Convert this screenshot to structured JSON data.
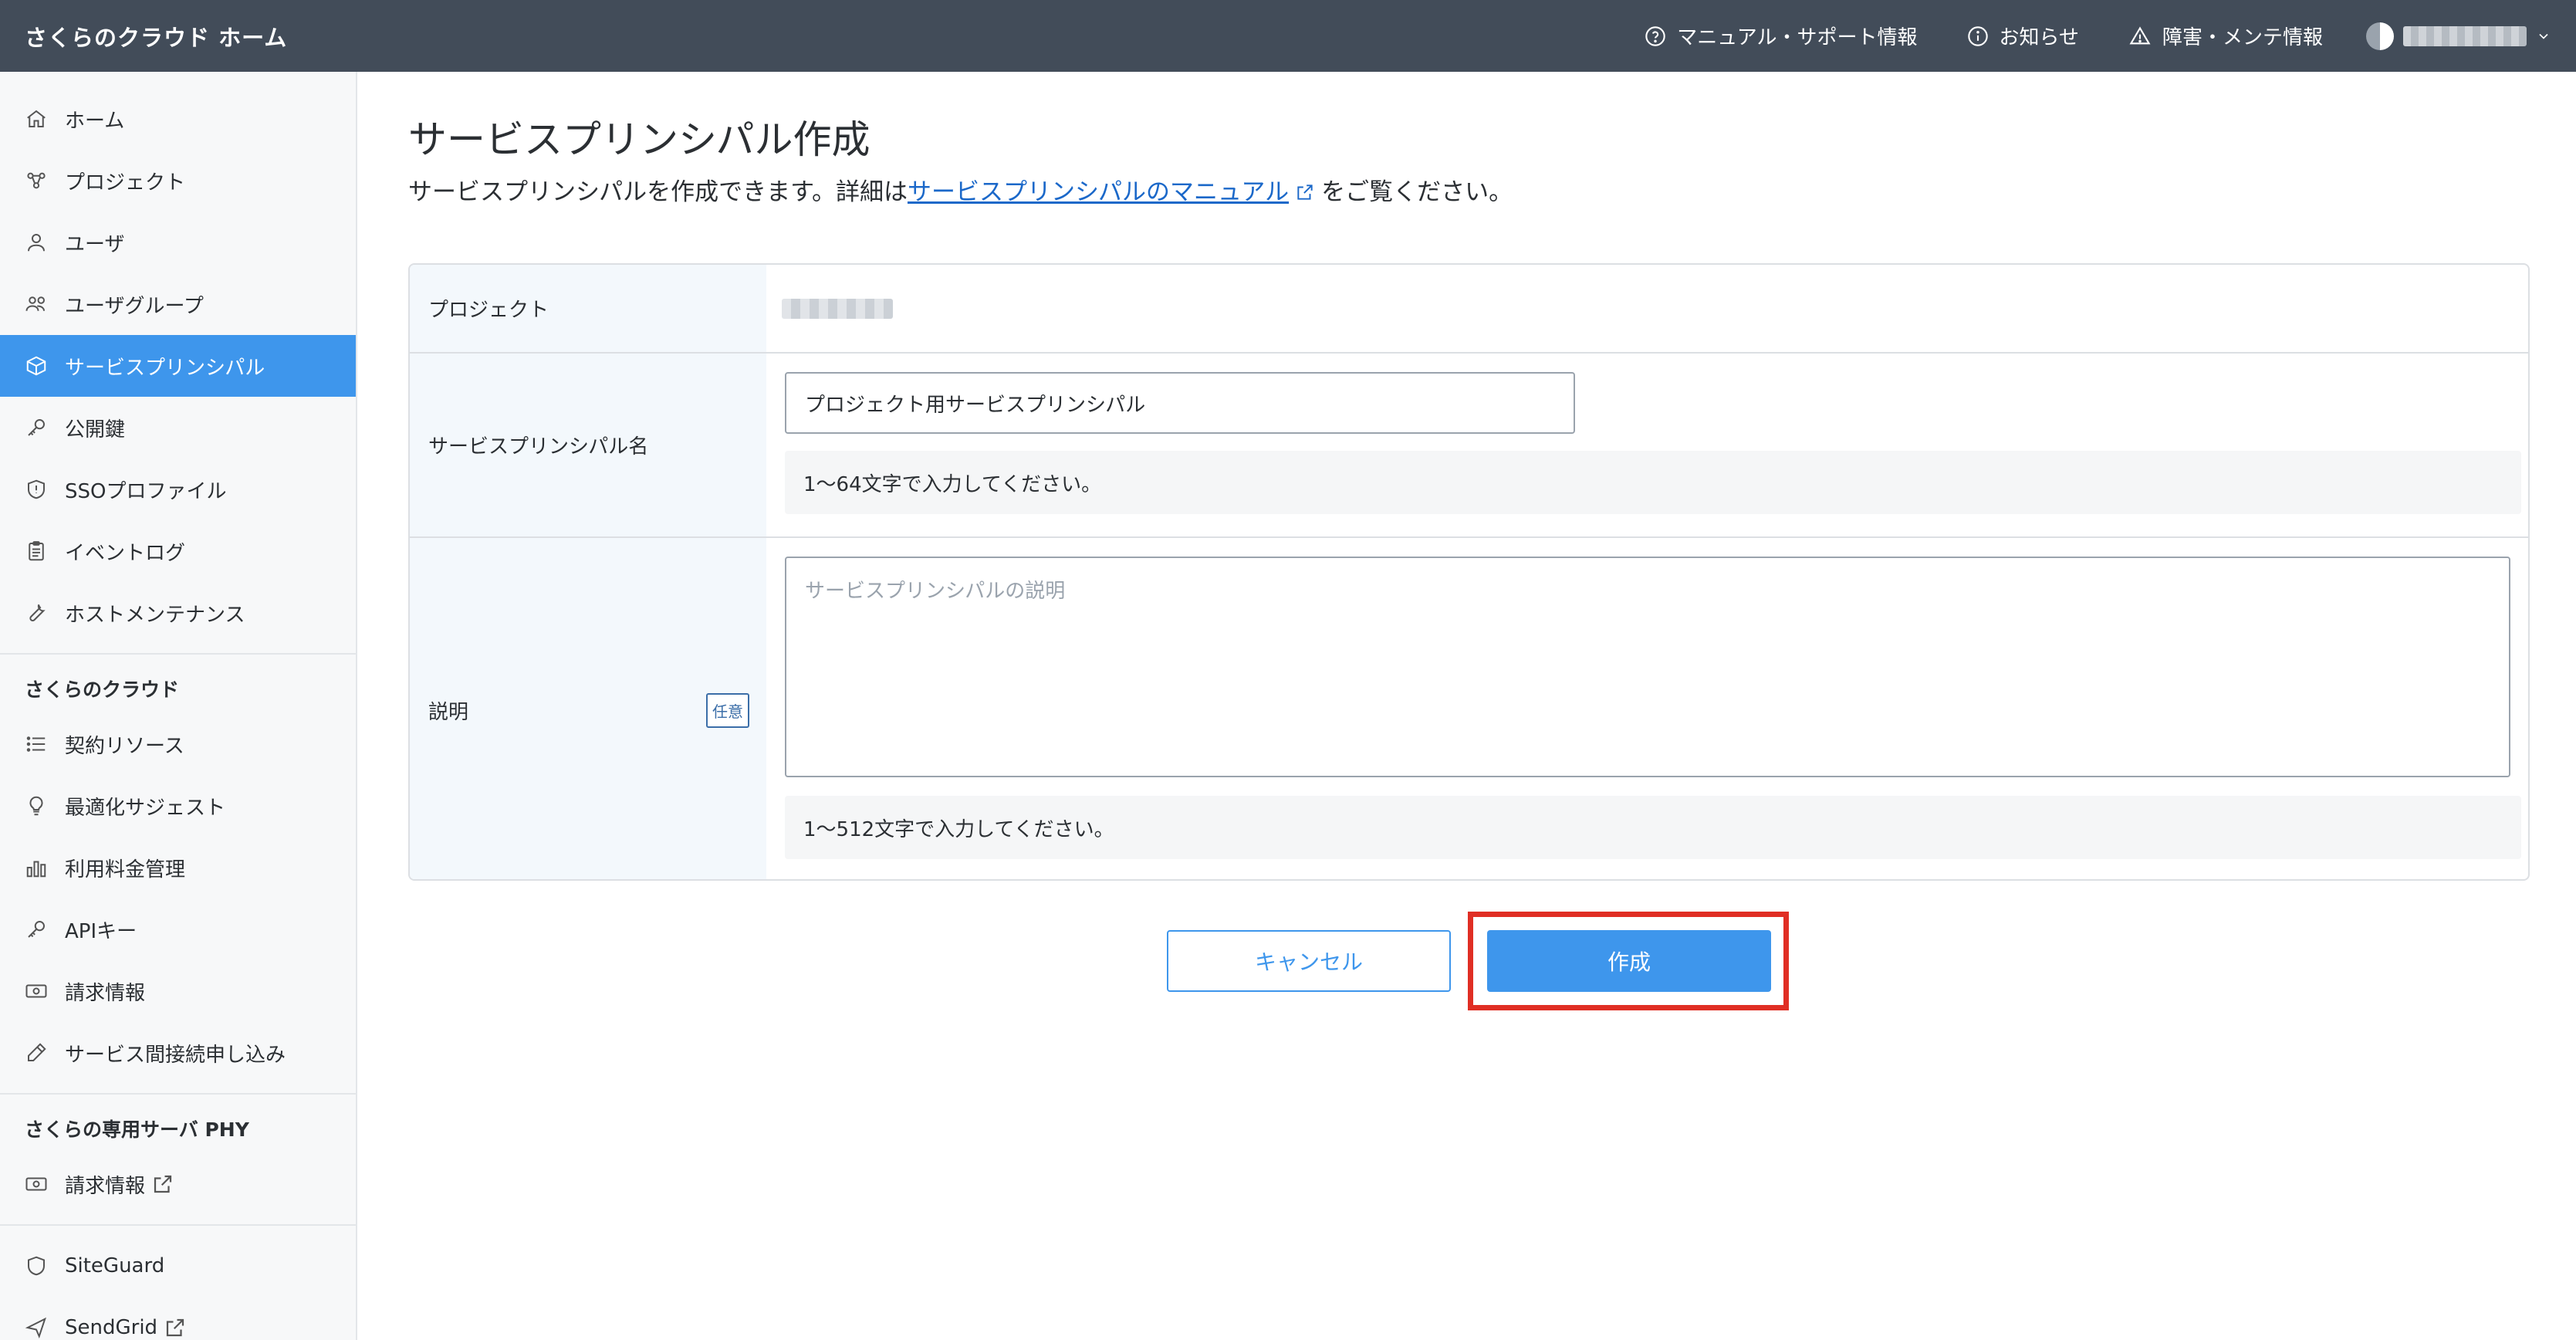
{
  "header": {
    "brand": "さくらのクラウド ホーム",
    "nav": [
      {
        "icon": "help-circle-icon",
        "label": "マニュアル・サポート情報"
      },
      {
        "icon": "info-circle-icon",
        "label": "お知らせ"
      },
      {
        "icon": "warning-triangle-icon",
        "label": "障害・メンテ情報"
      }
    ]
  },
  "sidebar": {
    "items": [
      {
        "icon": "home-icon",
        "label": "ホーム"
      },
      {
        "icon": "project-icon",
        "label": "プロジェクト"
      },
      {
        "icon": "user-icon",
        "label": "ユーザ"
      },
      {
        "icon": "user-group-icon",
        "label": "ユーザグループ"
      },
      {
        "icon": "cube-icon",
        "label": "サービスプリンシパル",
        "active": true
      },
      {
        "icon": "key-icon",
        "label": "公開鍵"
      },
      {
        "icon": "shield-icon",
        "label": "SSOプロファイル"
      },
      {
        "icon": "clipboard-icon",
        "label": "イベントログ"
      },
      {
        "icon": "wrench-icon",
        "label": "ホストメンテナンス"
      }
    ],
    "section_cloud": {
      "heading": "さくらのクラウド",
      "items": [
        {
          "icon": "list-icon",
          "label": "契約リソース"
        },
        {
          "icon": "lightbulb-icon",
          "label": "最適化サジェスト"
        },
        {
          "icon": "bar-chart-icon",
          "label": "利用料金管理"
        },
        {
          "icon": "key-icon",
          "label": "APIキー"
        },
        {
          "icon": "money-icon",
          "label": "請求情報"
        },
        {
          "icon": "pen-icon",
          "label": "サービス間接続申し込み"
        }
      ]
    },
    "section_phy": {
      "heading": "さくらの専用サーバ PHY",
      "items": [
        {
          "icon": "money-icon",
          "label": "請求情報"
        }
      ]
    },
    "extra_items": [
      {
        "icon": "shield-icon",
        "label": "SiteGuard"
      },
      {
        "icon": "send-icon",
        "label": "SendGrid"
      }
    ]
  },
  "main": {
    "title": "サービスプリンシパル作成",
    "description_before": "サービスプリンシパルを作成できます。詳細は",
    "description_link": "サービスプリンシパルのマニュアル",
    "description_after": "をご覧ください。",
    "form": {
      "project_label": "プロジェクト",
      "name_label": "サービスプリンシパル名",
      "name_value": "プロジェクト用サービスプリンシパル",
      "name_hint": "1〜64文字で入力してください。",
      "desc_label": "説明",
      "desc_badge": "任意",
      "desc_placeholder": "サービスプリンシパルの説明",
      "desc_hint": "1〜512文字で入力してください。"
    },
    "buttons": {
      "cancel": "キャンセル",
      "create": "作成"
    }
  },
  "colors": {
    "header_bg": "#424c59",
    "accent": "#3e96ec",
    "highlight": "#e02e24",
    "link": "#1b68c9"
  }
}
